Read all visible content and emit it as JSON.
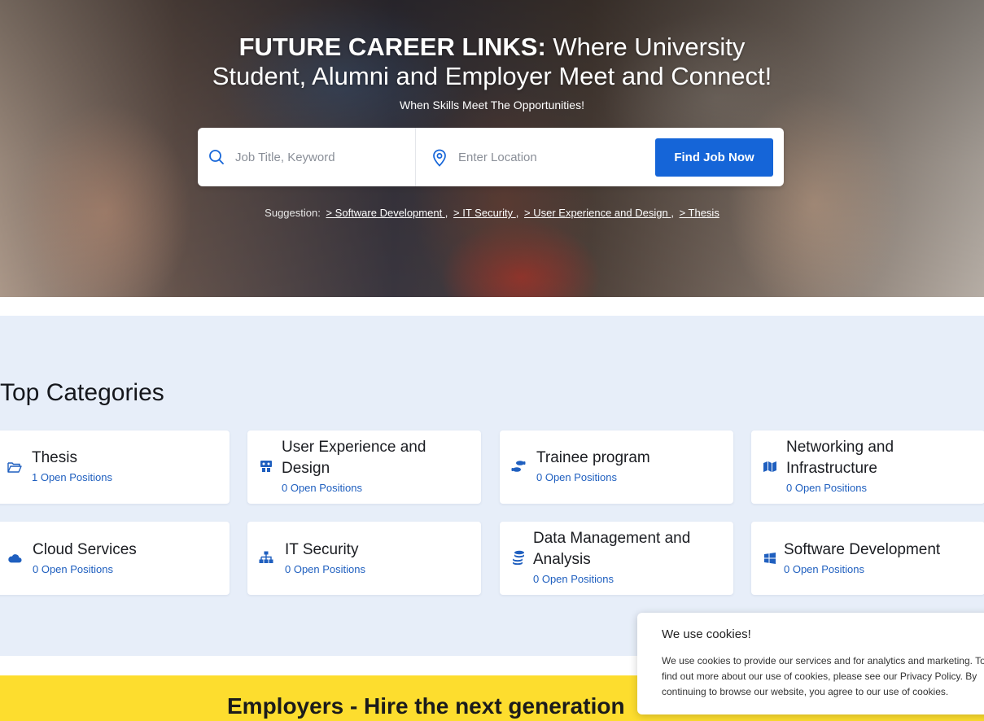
{
  "hero": {
    "title_bold": "FUTURE CAREER LINKS:",
    "title_rest1": " Where University",
    "title_line2": "Student, Alumni and Employer Meet and Connect!",
    "subtitle": "When Skills Meet The Opportunities!"
  },
  "search": {
    "keyword_placeholder": "Job Title, Keyword",
    "location_placeholder": "Enter Location",
    "button_label": "Find Job Now"
  },
  "suggestions": {
    "label": "Suggestion:",
    "items": [
      "> Software Development ",
      "> IT Security ",
      "> User Experience and Design ",
      "> Thesis"
    ]
  },
  "categories": {
    "title": "Top Categories",
    "items": [
      {
        "name": "Thesis",
        "positions": "1 Open Positions",
        "icon": "folder-open-icon"
      },
      {
        "name": "User Experience and Design",
        "positions": "0 Open Positions",
        "icon": "users-presentation-icon"
      },
      {
        "name": "Trainee program",
        "positions": "0 Open Positions",
        "icon": "shoe-prints-icon"
      },
      {
        "name": "Networking and Infrastructure",
        "positions": "0 Open Positions",
        "icon": "map-icon"
      },
      {
        "name": "Cloud Services",
        "positions": "0 Open Positions",
        "icon": "cloud-icon"
      },
      {
        "name": "IT Security",
        "positions": "0 Open Positions",
        "icon": "sitemap-icon"
      },
      {
        "name": "Data Management and Analysis",
        "positions": "0 Open Positions",
        "icon": "database-coins-icon"
      },
      {
        "name": "Software Development",
        "positions": "0 Open Positions",
        "icon": "windows-icon"
      }
    ]
  },
  "employers": {
    "title": "Employers - Hire the next generation"
  },
  "cookie": {
    "title": "We use cookies!",
    "text": "We use cookies to provide our services and for analytics and marketing. To find out more about our use of cookies, please see our Privacy Policy. By continuing to browse our website, you agree to our use of cookies."
  },
  "colors": {
    "accent": "#1565d8",
    "category_bg": "#e7eef9",
    "banner": "#fddd2e"
  }
}
